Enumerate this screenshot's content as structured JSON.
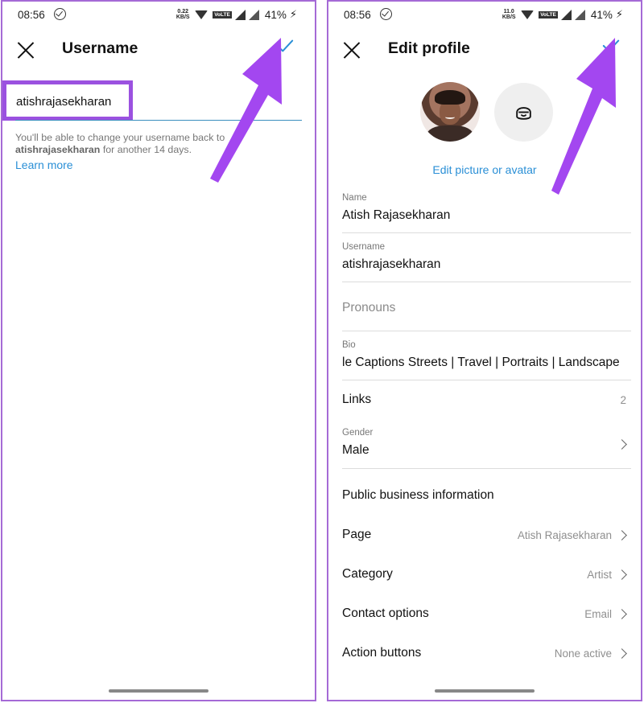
{
  "status_bar": {
    "time": "08:56",
    "speed_left": "0.22\nKB/S",
    "speed_right": "11.0\nKB/S",
    "volte": "VoLTE",
    "battery": "41%",
    "icons": [
      "check-circle-icon",
      "wifi-icon",
      "signal-icon",
      "battery-charging-icon"
    ]
  },
  "username_screen": {
    "title": "Username",
    "username_value": "atishrajasekharan",
    "helper_text": "You'll be able to change your username back to",
    "helper_bold": "atishrajasekharan",
    "helper_suffix": "for another 14 days.",
    "learn_more": "Learn more"
  },
  "edit_profile_screen": {
    "title": "Edit profile",
    "edit_picture": "Edit picture or avatar",
    "fields": {
      "name_label": "Name",
      "name_value": "Atish Rajasekharan",
      "username_label": "Username",
      "username_value": "atishrajasekharan",
      "pronouns_placeholder": "Pronouns",
      "bio_label": "Bio",
      "bio_value": "le Captions Streets | Travel | Portraits | Landscape"
    },
    "links_label": "Links",
    "links_count": "2",
    "gender_label": "Gender",
    "gender_value": "Male",
    "section_business": "Public business information",
    "page_label": "Page",
    "page_value": "Atish Rajasekharan",
    "category_label": "Category",
    "category_value": "Artist",
    "contact_label": "Contact options",
    "contact_value": "Email",
    "action_label": "Action buttons",
    "action_value": "None active"
  },
  "colors": {
    "accent_blue": "#2a8fd6",
    "highlight_purple": "#9b51e0",
    "arrow_purple": "#a347f0"
  }
}
